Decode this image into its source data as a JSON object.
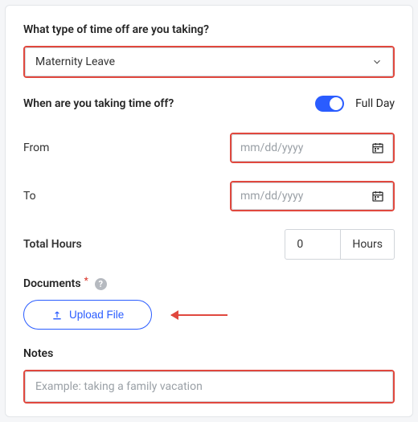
{
  "type_section": {
    "label": "What type of time off are you taking?",
    "selected": "Maternity Leave"
  },
  "when_section": {
    "label": "When are you taking time off?",
    "toggle_label": "Full Day"
  },
  "from": {
    "label": "From",
    "placeholder": "mm/dd/yyyy"
  },
  "to": {
    "label": "To",
    "placeholder": "mm/dd/yyyy"
  },
  "total_hours": {
    "label": "Total Hours",
    "value": "0",
    "unit": "Hours"
  },
  "documents": {
    "label": "Documents",
    "upload_label": "Upload File"
  },
  "notes": {
    "label": "Notes",
    "placeholder": "Example: taking a family vacation"
  }
}
